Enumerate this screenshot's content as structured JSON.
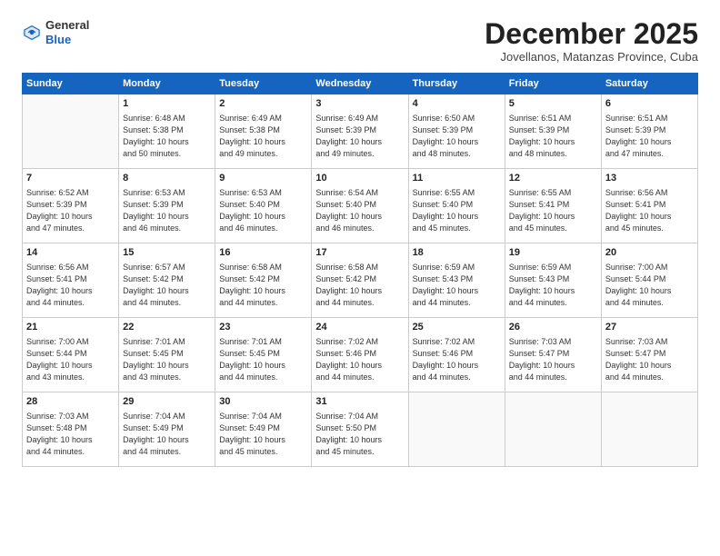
{
  "header": {
    "logo_general": "General",
    "logo_blue": "Blue",
    "month_title": "December 2025",
    "location": "Jovellanos, Matanzas Province, Cuba"
  },
  "weekdays": [
    "Sunday",
    "Monday",
    "Tuesday",
    "Wednesday",
    "Thursday",
    "Friday",
    "Saturday"
  ],
  "weeks": [
    [
      {
        "num": "",
        "info": ""
      },
      {
        "num": "1",
        "info": "Sunrise: 6:48 AM\nSunset: 5:38 PM\nDaylight: 10 hours\nand 50 minutes."
      },
      {
        "num": "2",
        "info": "Sunrise: 6:49 AM\nSunset: 5:38 PM\nDaylight: 10 hours\nand 49 minutes."
      },
      {
        "num": "3",
        "info": "Sunrise: 6:49 AM\nSunset: 5:39 PM\nDaylight: 10 hours\nand 49 minutes."
      },
      {
        "num": "4",
        "info": "Sunrise: 6:50 AM\nSunset: 5:39 PM\nDaylight: 10 hours\nand 48 minutes."
      },
      {
        "num": "5",
        "info": "Sunrise: 6:51 AM\nSunset: 5:39 PM\nDaylight: 10 hours\nand 48 minutes."
      },
      {
        "num": "6",
        "info": "Sunrise: 6:51 AM\nSunset: 5:39 PM\nDaylight: 10 hours\nand 47 minutes."
      }
    ],
    [
      {
        "num": "7",
        "info": "Sunrise: 6:52 AM\nSunset: 5:39 PM\nDaylight: 10 hours\nand 47 minutes."
      },
      {
        "num": "8",
        "info": "Sunrise: 6:53 AM\nSunset: 5:39 PM\nDaylight: 10 hours\nand 46 minutes."
      },
      {
        "num": "9",
        "info": "Sunrise: 6:53 AM\nSunset: 5:40 PM\nDaylight: 10 hours\nand 46 minutes."
      },
      {
        "num": "10",
        "info": "Sunrise: 6:54 AM\nSunset: 5:40 PM\nDaylight: 10 hours\nand 46 minutes."
      },
      {
        "num": "11",
        "info": "Sunrise: 6:55 AM\nSunset: 5:40 PM\nDaylight: 10 hours\nand 45 minutes."
      },
      {
        "num": "12",
        "info": "Sunrise: 6:55 AM\nSunset: 5:41 PM\nDaylight: 10 hours\nand 45 minutes."
      },
      {
        "num": "13",
        "info": "Sunrise: 6:56 AM\nSunset: 5:41 PM\nDaylight: 10 hours\nand 45 minutes."
      }
    ],
    [
      {
        "num": "14",
        "info": "Sunrise: 6:56 AM\nSunset: 5:41 PM\nDaylight: 10 hours\nand 44 minutes."
      },
      {
        "num": "15",
        "info": "Sunrise: 6:57 AM\nSunset: 5:42 PM\nDaylight: 10 hours\nand 44 minutes."
      },
      {
        "num": "16",
        "info": "Sunrise: 6:58 AM\nSunset: 5:42 PM\nDaylight: 10 hours\nand 44 minutes."
      },
      {
        "num": "17",
        "info": "Sunrise: 6:58 AM\nSunset: 5:42 PM\nDaylight: 10 hours\nand 44 minutes."
      },
      {
        "num": "18",
        "info": "Sunrise: 6:59 AM\nSunset: 5:43 PM\nDaylight: 10 hours\nand 44 minutes."
      },
      {
        "num": "19",
        "info": "Sunrise: 6:59 AM\nSunset: 5:43 PM\nDaylight: 10 hours\nand 44 minutes."
      },
      {
        "num": "20",
        "info": "Sunrise: 7:00 AM\nSunset: 5:44 PM\nDaylight: 10 hours\nand 44 minutes."
      }
    ],
    [
      {
        "num": "21",
        "info": "Sunrise: 7:00 AM\nSunset: 5:44 PM\nDaylight: 10 hours\nand 43 minutes."
      },
      {
        "num": "22",
        "info": "Sunrise: 7:01 AM\nSunset: 5:45 PM\nDaylight: 10 hours\nand 43 minutes."
      },
      {
        "num": "23",
        "info": "Sunrise: 7:01 AM\nSunset: 5:45 PM\nDaylight: 10 hours\nand 44 minutes."
      },
      {
        "num": "24",
        "info": "Sunrise: 7:02 AM\nSunset: 5:46 PM\nDaylight: 10 hours\nand 44 minutes."
      },
      {
        "num": "25",
        "info": "Sunrise: 7:02 AM\nSunset: 5:46 PM\nDaylight: 10 hours\nand 44 minutes."
      },
      {
        "num": "26",
        "info": "Sunrise: 7:03 AM\nSunset: 5:47 PM\nDaylight: 10 hours\nand 44 minutes."
      },
      {
        "num": "27",
        "info": "Sunrise: 7:03 AM\nSunset: 5:47 PM\nDaylight: 10 hours\nand 44 minutes."
      }
    ],
    [
      {
        "num": "28",
        "info": "Sunrise: 7:03 AM\nSunset: 5:48 PM\nDaylight: 10 hours\nand 44 minutes."
      },
      {
        "num": "29",
        "info": "Sunrise: 7:04 AM\nSunset: 5:49 PM\nDaylight: 10 hours\nand 44 minutes."
      },
      {
        "num": "30",
        "info": "Sunrise: 7:04 AM\nSunset: 5:49 PM\nDaylight: 10 hours\nand 45 minutes."
      },
      {
        "num": "31",
        "info": "Sunrise: 7:04 AM\nSunset: 5:50 PM\nDaylight: 10 hours\nand 45 minutes."
      },
      {
        "num": "",
        "info": ""
      },
      {
        "num": "",
        "info": ""
      },
      {
        "num": "",
        "info": ""
      }
    ]
  ]
}
